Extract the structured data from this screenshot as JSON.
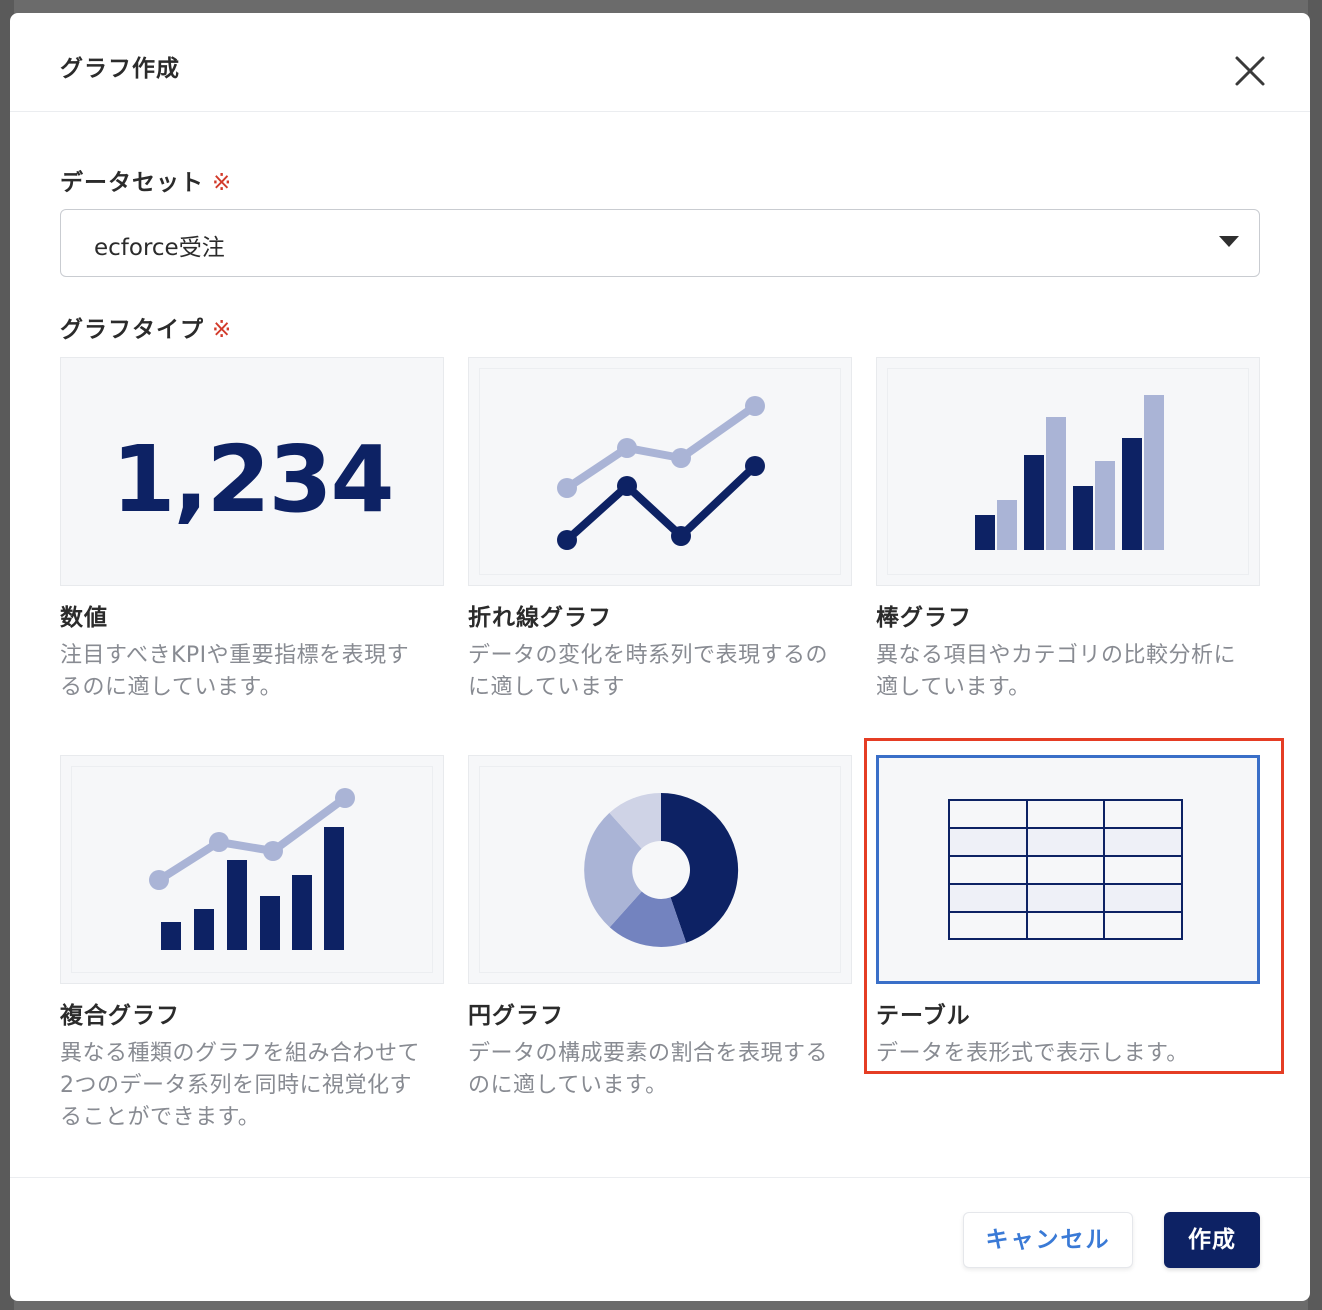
{
  "dialog": {
    "title": "グラフ作成",
    "close_icon": "close-icon"
  },
  "dataset": {
    "label": "データセット",
    "required_mark": "※",
    "selected_value": "ecforce受注"
  },
  "graph_type": {
    "label": "グラフタイプ",
    "required_mark": "※",
    "cards": [
      {
        "name": "数値",
        "desc_line1": "注目すべきKPIや重要指標を表現す",
        "desc_line2": "るのに適しています。",
        "sample_number": "1,234",
        "icon": "number-icon"
      },
      {
        "name": "折れ線グラフ",
        "desc_line1": "データの変化を時系列で表現するの",
        "desc_line2": "に適しています",
        "icon": "line-chart-icon"
      },
      {
        "name": "棒グラフ",
        "desc_line1": "異なる項目やカテゴリの比較分析に",
        "desc_line2": "適しています。",
        "icon": "bar-chart-icon"
      },
      {
        "name": "複合グラフ",
        "desc_line1": "異なる種類のグラフを組み合わせて",
        "desc_line2": "2つのデータ系列を同時に視覚化す",
        "desc_line3": "ることができます。",
        "icon": "combo-chart-icon"
      },
      {
        "name": "円グラフ",
        "desc_line1": "データの構成要素の割合を表現する",
        "desc_line2": "のに適しています。",
        "icon": "pie-chart-icon"
      },
      {
        "name": "テーブル",
        "desc_line1": "データを表形式で表示します。",
        "icon": "table-icon",
        "selected": true
      }
    ]
  },
  "footer": {
    "cancel_label": "キャンセル",
    "create_label": "作成"
  },
  "colors": {
    "primary_navy": "#0d2264",
    "light_navy": "#aab4d6",
    "selected_border": "#3a6fc8",
    "highlight_border": "#e53d24",
    "required_red": "#d23a2a",
    "link_blue": "#3a7ad6"
  }
}
